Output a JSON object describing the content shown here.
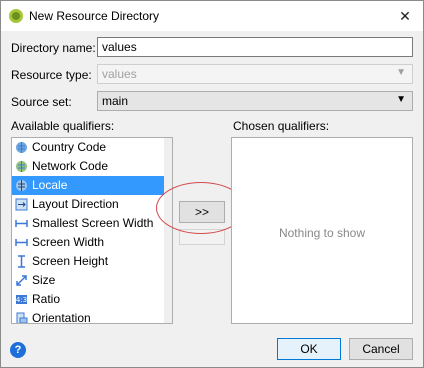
{
  "window": {
    "title": "New Resource Directory",
    "close_glyph": "✕"
  },
  "form": {
    "directory_name_label": "Directory name:",
    "directory_name_value": "values",
    "resource_type_label": "Resource type:",
    "resource_type_value": "values",
    "source_set_label": "Source set:",
    "source_set_value": "main"
  },
  "available": {
    "label": "Available qualifiers:",
    "items": [
      {
        "label": "Country Code",
        "icon": "globe-icon"
      },
      {
        "label": "Network Code",
        "icon": "globe-icon"
      },
      {
        "label": "Locale",
        "icon": "globe-icon"
      },
      {
        "label": "Layout Direction",
        "icon": "layout-direction-icon"
      },
      {
        "label": "Smallest Screen Width",
        "icon": "width-icon"
      },
      {
        "label": "Screen Width",
        "icon": "width-icon"
      },
      {
        "label": "Screen Height",
        "icon": "height-icon"
      },
      {
        "label": "Size",
        "icon": "size-icon"
      },
      {
        "label": "Ratio",
        "icon": "ratio-icon"
      },
      {
        "label": "Orientation",
        "icon": "orientation-icon"
      }
    ]
  },
  "chosen": {
    "label": "Chosen qualifiers:",
    "empty_text": "Nothing to show"
  },
  "buttons": {
    "move_right": ">>",
    "ok": "OK",
    "cancel": "Cancel",
    "help": "?"
  },
  "colors": {
    "selection": "#3399ff",
    "annotation": "#d34a4a"
  }
}
